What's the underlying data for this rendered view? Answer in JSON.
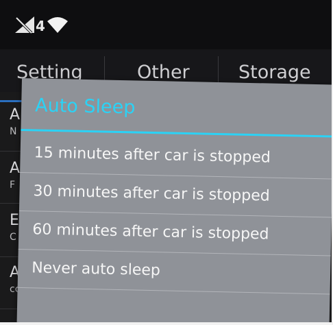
{
  "status_bar": {
    "icons": [
      "signal-off-icon",
      "wifi-icon"
    ],
    "signal_label": "4"
  },
  "tabs": [
    {
      "label": "Setting"
    },
    {
      "label": "Other"
    },
    {
      "label": "Storage"
    }
  ],
  "background_list": [
    {
      "title": "A",
      "subtitle": "N"
    },
    {
      "title": "A",
      "subtitle": "F"
    },
    {
      "title": "E",
      "subtitle": "C"
    },
    {
      "title": "A",
      "subtitle": "cc"
    }
  ],
  "dialog": {
    "title": "Auto Sleep",
    "options": [
      {
        "label": "15 minutes after car is stopped"
      },
      {
        "label": "30 minutes after car is stopped"
      },
      {
        "label": "60 minutes after car is stopped"
      },
      {
        "label": "Never auto sleep"
      }
    ]
  },
  "colors": {
    "accent": "#2bd2f5",
    "dialog_bg": "#8f9298",
    "screen_bg": "#1a1a1b"
  }
}
